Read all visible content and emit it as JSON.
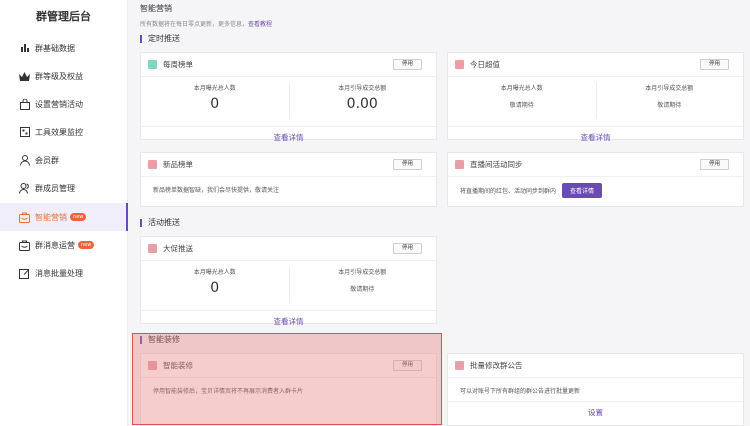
{
  "sidebar": {
    "title": "群管理后台",
    "items": [
      {
        "label": "群基础数据",
        "icon": "bar-chart-icon"
      },
      {
        "label": "群等级及权益",
        "icon": "crown-icon"
      },
      {
        "label": "设置营销活动",
        "icon": "shopping-bag-icon"
      },
      {
        "label": "工具效果监控",
        "icon": "monitor-icon"
      },
      {
        "label": "会员群",
        "icon": "member-icon"
      },
      {
        "label": "群成员管理",
        "icon": "users-icon"
      },
      {
        "label": "智能营销",
        "icon": "smart-marketing-icon",
        "badge": "new"
      },
      {
        "label": "群消息运营",
        "icon": "message-icon",
        "badge": "new"
      },
      {
        "label": "消息批量处理",
        "icon": "edit-icon"
      }
    ]
  },
  "main": {
    "title": "智能营销",
    "note": "所有数据将在每日零点更新，更多信息，",
    "note_link": "查看教程",
    "sections": {
      "scheduled": "定时推送",
      "activity": "活动推送",
      "smart_decor": "智能装修"
    },
    "cards": {
      "weekly": {
        "title": "每周榜单",
        "stop": "停用",
        "stat1_label": "本月曝光总人数",
        "stat1_value": "0",
        "stat2_label": "本月引导成交总额",
        "stat2_value": "0.00",
        "link": "查看详情"
      },
      "today": {
        "title": "今日超值",
        "stop": "停用",
        "stat1_label": "本月曝光总人数",
        "stat1_value": "敬请期待",
        "stat2_label": "本月引导成交总额",
        "stat2_value": "敬请期待",
        "link": "查看详情"
      },
      "new_products": {
        "title": "新品榜单",
        "stop": "停用",
        "desc": "新品榜单数据智缺，我们会尽快提供，敬请关注"
      },
      "live": {
        "title": "直播间活动同步",
        "stop": "停用",
        "desc": "将直播期间的红包、活动同步到群内",
        "button": "查看详情"
      },
      "promo": {
        "title": "大促推送",
        "stop": "停用",
        "stat1_label": "本月曝光总人数",
        "stat1_value": "0",
        "stat2_label": "本月引导成交总额",
        "stat2_value": "敬请期待",
        "link": "查看详情"
      },
      "decor": {
        "title": "智能装修",
        "stop": "停用",
        "desc": "停用智能装修后，宝贝详情页将不再展示消费者入群卡片"
      },
      "announce": {
        "title": "批量修改群公告",
        "desc": "可以对账号下所有群组的群公告进行批量更新",
        "link": "设置"
      }
    }
  },
  "colors": {
    "accent": "#6a4ab3",
    "active_text": "#e0743f",
    "weekly_dot": "#7fd8c4",
    "pink_dot": "#e7a0a8",
    "highlight": "#d9534f"
  }
}
